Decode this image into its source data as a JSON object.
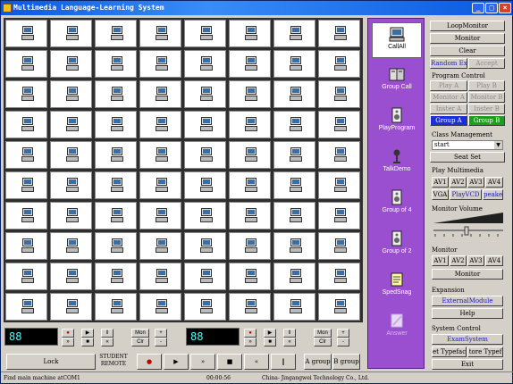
{
  "window": {
    "title": "Multimedia Language-Learning System"
  },
  "grid": {
    "rows": 10,
    "cols": 8,
    "icon": "computer-icon"
  },
  "side_tools": [
    {
      "label": "CallAll",
      "icon": "computer-icon",
      "selected": true,
      "enabled": true
    },
    {
      "label": "Group Call",
      "icon": "server-icon",
      "selected": false,
      "enabled": true
    },
    {
      "label": "PlayProgram",
      "icon": "speaker-icon",
      "selected": false,
      "enabled": true
    },
    {
      "label": "TalkDemo",
      "icon": "microphone-icon",
      "selected": false,
      "enabled": true
    },
    {
      "label": "Group of 4",
      "icon": "group-icon",
      "selected": false,
      "enabled": true
    },
    {
      "label": "Group of 2",
      "icon": "group-icon",
      "selected": false,
      "enabled": true
    },
    {
      "label": "SpedSnag",
      "icon": "notepad-icon",
      "selected": false,
      "enabled": true
    },
    {
      "label": "Answer",
      "icon": "pen-icon",
      "selected": false,
      "enabled": false
    }
  ],
  "panel": {
    "loop_monitor": "LoopMonitor",
    "monitor": "Monitor",
    "clear": "Clear",
    "random_exam": "Random Exa",
    "accept": "Accept",
    "program_control": "Program Control",
    "play_a": "Play A",
    "play_b": "Play B",
    "monitor_a": "Monitor A",
    "monitor_b": "Monitor B",
    "inster_a": "Inster A",
    "inster_b": "Inster B",
    "group_a": "Group A",
    "group_b": "Group B",
    "class_management": "Class Management",
    "class_select": "start",
    "seat_set": "Seat Set",
    "play_multimedia": "Play Multimedia",
    "av_buttons": [
      "AV1",
      "AV2",
      "AV3",
      "AV4"
    ],
    "vga": "VGA",
    "playvcd": "PlayVCD",
    "speaker": "peaker",
    "monitor_volume": "Monitor Volume",
    "monitor_section": "Monitor",
    "av_buttons2": [
      "AV1",
      "AV2",
      "AV3",
      "AV4"
    ],
    "monitor_btn": "Monitor",
    "expansion": "Expansion",
    "external_module": "ExternalModule",
    "help": "Help",
    "system_control": "System Control",
    "exam_system": "ExamSystem",
    "set_typeface": "et Typefac",
    "restore_typeface": "tore Typef",
    "exit": "Exit"
  },
  "left_controls": {
    "lcd1": "88",
    "lcd2": "88",
    "mon": "Mon",
    "clr": "Clr",
    "plus": "+",
    "minus": "-"
  },
  "bottom": {
    "lock": "Lock",
    "student_remote_1": "STUDENT",
    "student_remote_2": "REMOTE",
    "a_group": "A group",
    "b_group": "B group"
  },
  "status": {
    "left": "Find main machine atCOM1",
    "time": "00:00:56",
    "company": "China- Jingangwei Technology Co., Ltd."
  }
}
